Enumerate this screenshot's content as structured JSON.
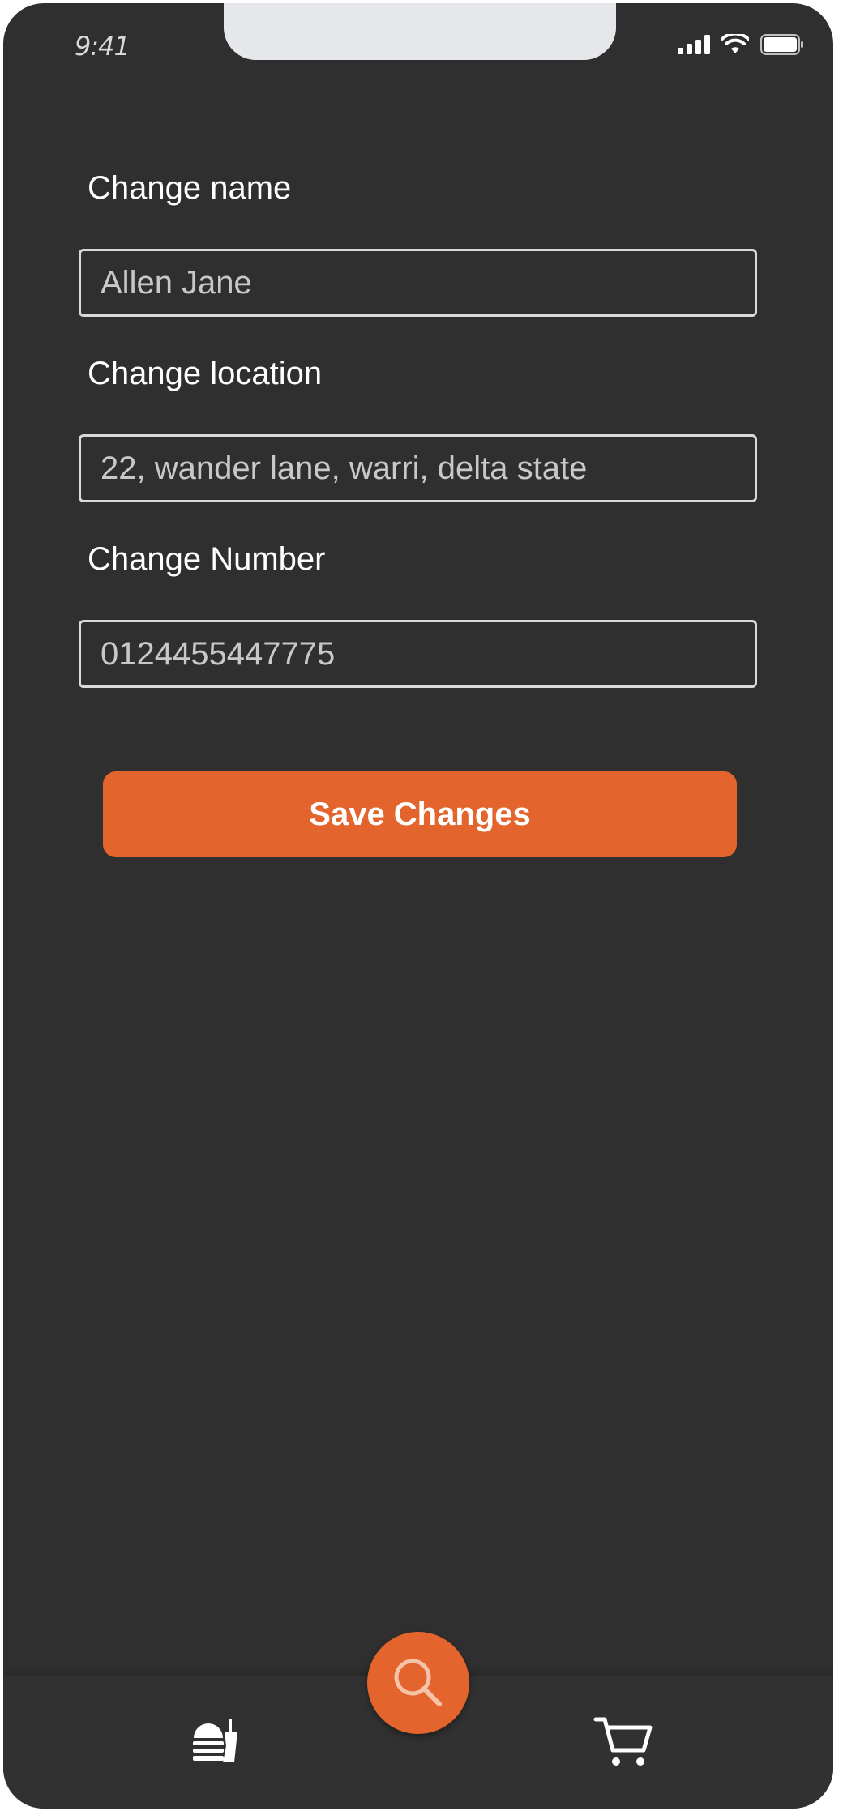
{
  "status_bar": {
    "time": "9:41",
    "icons": [
      "signal-icon",
      "wifi-icon",
      "battery-icon"
    ]
  },
  "form": {
    "name": {
      "label": "Change name",
      "value": "Allen Jane"
    },
    "location": {
      "label": "Change location",
      "value": "22, wander lane, warri, delta state"
    },
    "number": {
      "label": "Change Number",
      "value": "0124455447775"
    }
  },
  "save_button": {
    "label": "Save Changes"
  },
  "bottom_nav": {
    "items": [
      "food-menu-icon",
      "search-icon",
      "cart-icon"
    ]
  },
  "colors": {
    "background": "#2f2f2f",
    "accent": "#e4642d",
    "input_border": "#d9d9d9",
    "text": "#ffffff"
  }
}
